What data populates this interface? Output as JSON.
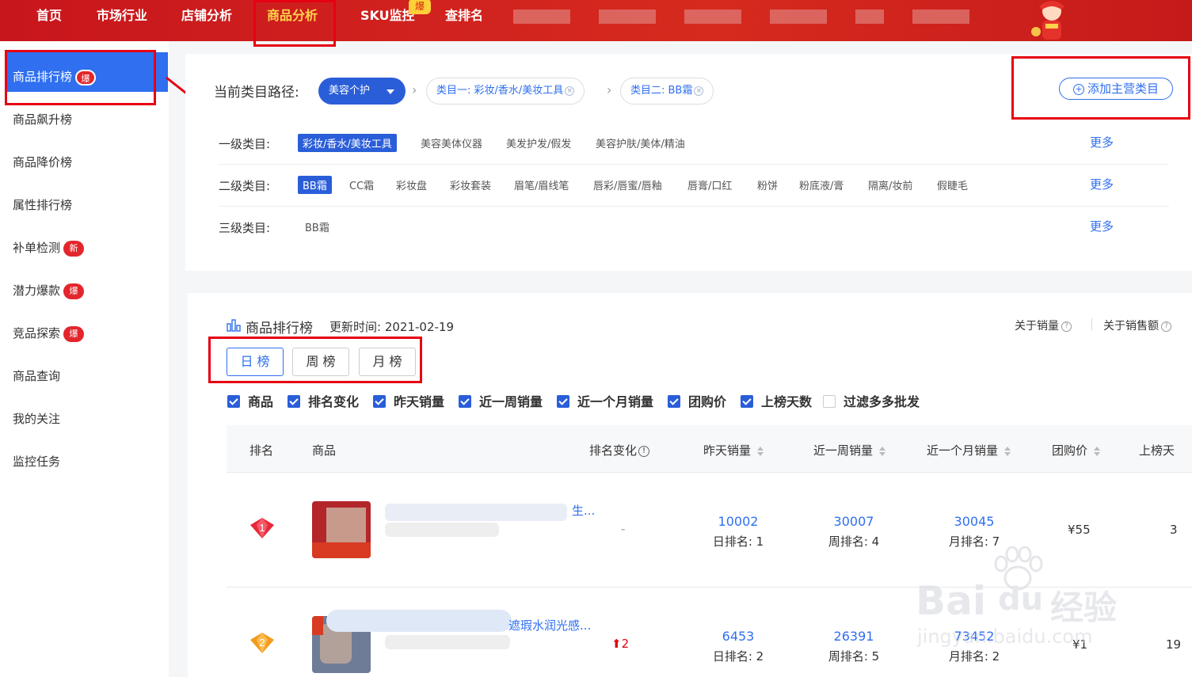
{
  "topnav": {
    "items": [
      "首页",
      "市场行业",
      "店铺分析",
      "商品分析",
      "SKU监控",
      "查排名"
    ],
    "hot_badge": "爆"
  },
  "sidebar": {
    "items": [
      {
        "label": "商品排行榜",
        "badge": "爆"
      },
      {
        "label": "商品飙升榜",
        "badge": ""
      },
      {
        "label": "商品降价榜",
        "badge": ""
      },
      {
        "label": "属性排行榜",
        "badge": ""
      },
      {
        "label": "补单检测",
        "badge": "新"
      },
      {
        "label": "潜力爆款",
        "badge": "爆"
      },
      {
        "label": "竞品探索",
        "badge": "爆"
      },
      {
        "label": "商品查询",
        "badge": ""
      },
      {
        "label": "我的关注",
        "badge": ""
      },
      {
        "label": "监控任务",
        "badge": ""
      }
    ]
  },
  "category": {
    "path_label": "当前类目路径:",
    "root_select": "美容个护",
    "chip1": "类目一:  彩妆/香水/美妆工具",
    "chip2": "类目二:  BB霜",
    "add_button": "添加主营类目",
    "level1_label": "一级类目:",
    "level1": [
      "彩妆/香水/美妆工具",
      "美容美体仪器",
      "美发护发/假发",
      "美容护肤/美体/精油"
    ],
    "level2_label": "二级类目:",
    "level2": [
      "BB霜",
      "CC霜",
      "彩妆盘",
      "彩妆套装",
      "眉笔/眉线笔",
      "唇彩/唇蜜/唇釉",
      "唇膏/口红",
      "粉饼",
      "粉底液/膏",
      "隔离/妆前",
      "假睫毛"
    ],
    "level3_label": "三级类目:",
    "level3": [
      "BB霜"
    ],
    "more": "更多"
  },
  "ranking": {
    "title": "商品排行榜",
    "update_time": "更新时间: 2021-02-19",
    "about_sales": "关于销量",
    "about_amount": "关于销售额",
    "tabs": [
      "日 榜",
      "周 榜",
      "月 榜"
    ],
    "filters": [
      {
        "label": "商品",
        "checked": true
      },
      {
        "label": "排名变化",
        "checked": true
      },
      {
        "label": "昨天销量",
        "checked": true
      },
      {
        "label": "近一周销量",
        "checked": true
      },
      {
        "label": "近一个月销量",
        "checked": true
      },
      {
        "label": "团购价",
        "checked": true
      },
      {
        "label": "上榜天数",
        "checked": true
      },
      {
        "label": "过滤多多批发",
        "checked": false
      }
    ],
    "columns": [
      "排名",
      "商品",
      "排名变化",
      "昨天销量",
      "近一周销量",
      "近一个月销量",
      "团购价",
      "上榜天"
    ],
    "rows": [
      {
        "rank": "1",
        "title_tail": "生...",
        "rank_change": "-",
        "yesterday": "10002",
        "yesterday_rank": "日排名: 1",
        "week": "30007",
        "week_rank": "周排名: 4",
        "month": "30045",
        "month_rank": "月排名: 7",
        "price": "¥55",
        "days": "3"
      },
      {
        "rank": "2",
        "title_tail": "遮瑕水润光感...",
        "rank_change": "2",
        "yesterday": "6453",
        "yesterday_rank": "日排名: 2",
        "week": "26391",
        "week_rank": "周排名: 5",
        "month": "73452",
        "month_rank": "月排名: 2",
        "price": "¥1",
        "days": "19"
      }
    ]
  },
  "watermark": {
    "brand": "Bai",
    "brand2": "du",
    "cn": "经验",
    "url": "jingyan.baidu.com"
  },
  "colors": {
    "topbar": "#c8161d",
    "primary": "#2a5ed9",
    "highlight": "#e60012"
  }
}
